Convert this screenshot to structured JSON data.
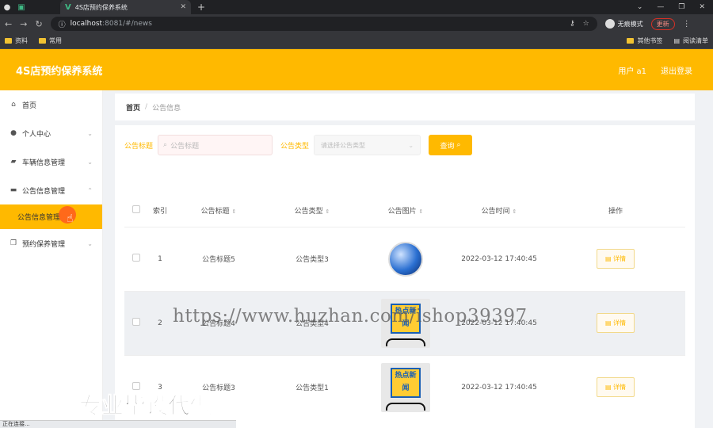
{
  "browser": {
    "tab_title": "4S店预约保养系统",
    "url_host": "localhost",
    "url_rest": ":8081/#/news",
    "incognito_label": "无痕模式",
    "update_label": "更新",
    "bookmarks": [
      "资料",
      "常用"
    ],
    "bookmarks_right": [
      "其他书签",
      "阅读清单"
    ]
  },
  "header": {
    "title": "4S店预约保养系统",
    "user": "用户 a1",
    "logout": "退出登录"
  },
  "sidebar": {
    "items": [
      {
        "label": "首页",
        "icon": "home-icon"
      },
      {
        "label": "个人中心",
        "icon": "user-icon"
      },
      {
        "label": "车辆信息管理",
        "icon": "car-icon"
      },
      {
        "label": "公告信息管理",
        "icon": "monitor-icon"
      },
      {
        "label": "公告信息管理",
        "icon": ""
      },
      {
        "label": "预约保养管理",
        "icon": "copy-icon"
      }
    ]
  },
  "breadcrumb": {
    "home": "首页",
    "sep": "/",
    "current": "公告信息"
  },
  "filters": {
    "title_label": "公告标题",
    "title_placeholder": "公告标题",
    "type_label": "公告类型",
    "type_placeholder": "请选择公告类型",
    "query_button": "查询"
  },
  "table": {
    "headers": [
      "索引",
      "公告标题",
      "公告类型",
      "公告图片",
      "公告时间",
      "操作"
    ],
    "rows": [
      {
        "index": "1",
        "title": "公告标题5",
        "type": "公告类型3",
        "time": "2022-03-12 17:40:45",
        "image": "globe",
        "action": "详情"
      },
      {
        "index": "2",
        "title": "公告标题4",
        "type": "公告类型4",
        "time": "2022-03-12 17:40:45",
        "image": "news",
        "action": "详情"
      },
      {
        "index": "3",
        "title": "公告标题3",
        "type": "公告类型1",
        "time": "2022-03-12 17:40:45",
        "image": "news",
        "action": "详情"
      }
    ],
    "news_badge_text": "热点新闻"
  },
  "overlay": {
    "watermark": "https://www.huzhan.com/ishop39397",
    "caption": "专业毕设代做",
    "status": "正在连接..."
  }
}
